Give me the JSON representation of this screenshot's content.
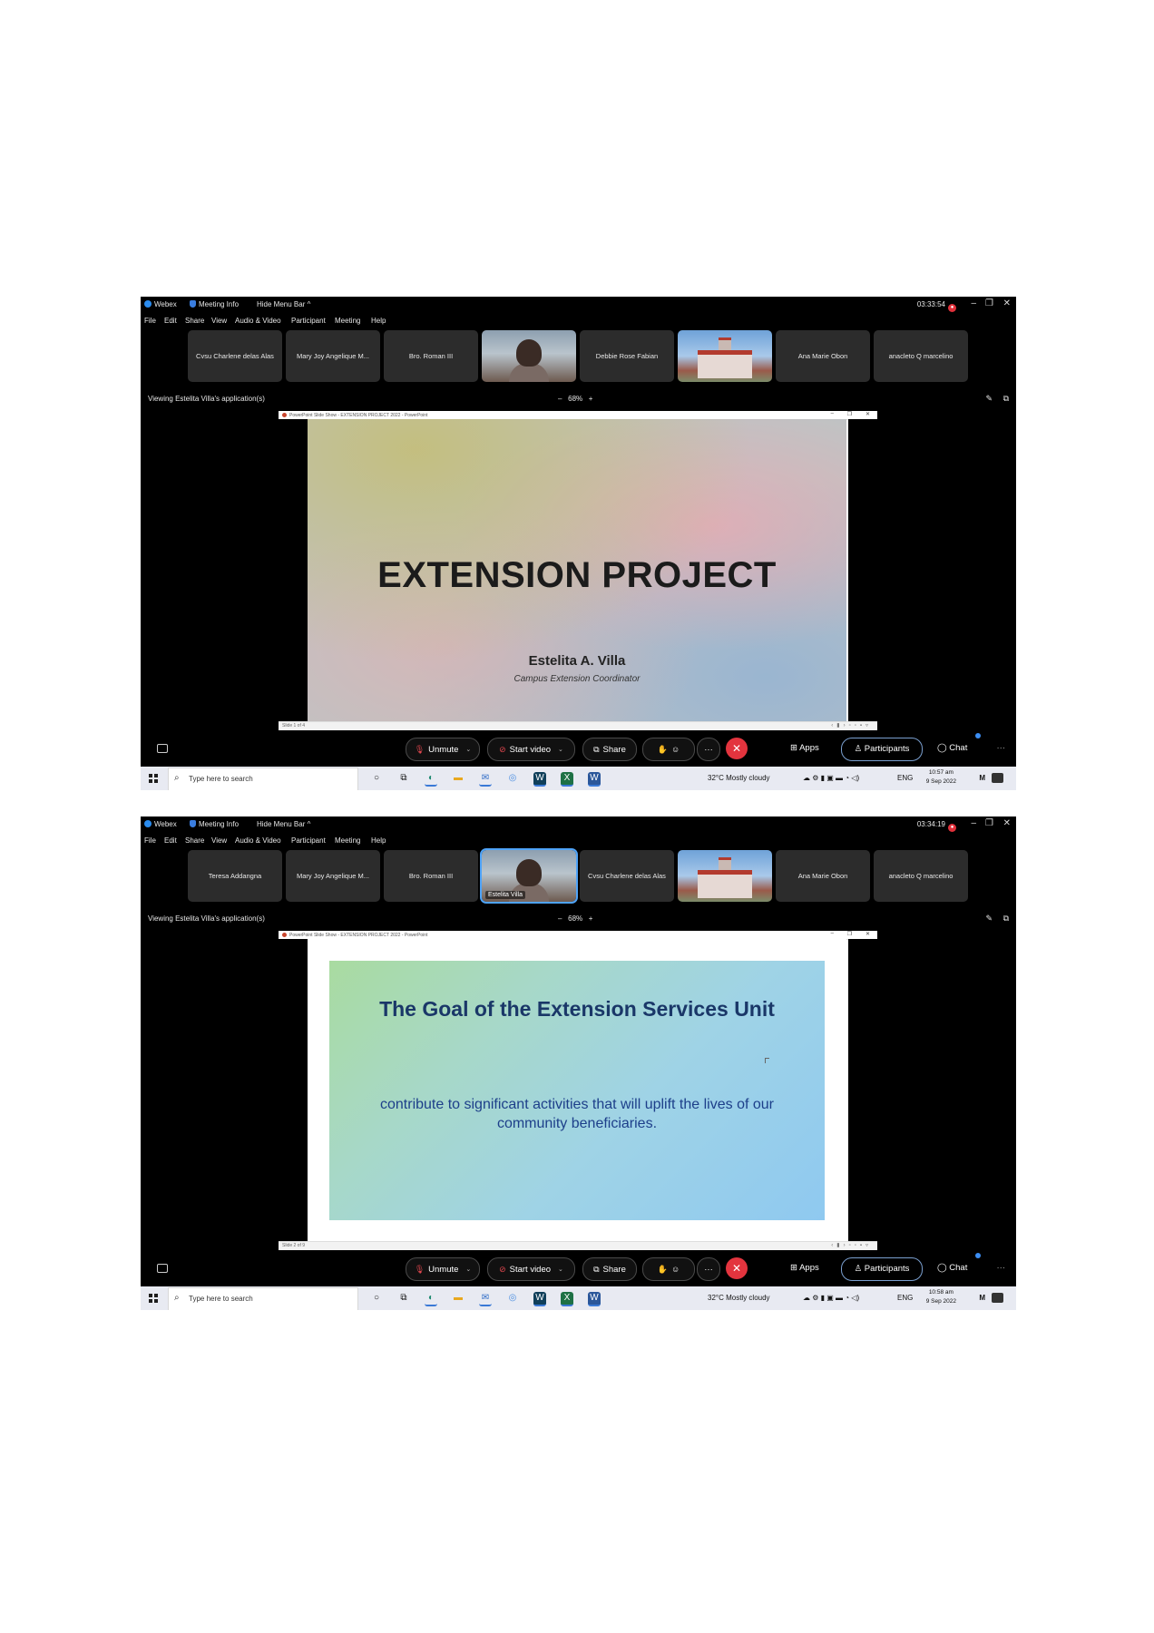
{
  "screenshots": [
    {
      "titlebar": {
        "app": "Webex",
        "meeting_info": "Meeting Info",
        "hide_menu": "Hide Menu Bar ^",
        "timer": "03:33:54"
      },
      "menu": [
        "File",
        "Edit",
        "Share",
        "View",
        "Audio & Video",
        "Participant",
        "Meeting",
        "Help"
      ],
      "participants": [
        "Cvsu Charlene delas Alas",
        "Mary Joy Angelique M...",
        "Bro. Roman III",
        "",
        "Debbie Rose Fabian",
        "",
        "Ana Marie Obon",
        "anacleto Q marcelino"
      ],
      "viewing": "Viewing Estelita Villa's application(s)",
      "zoom": "68%",
      "ppt_title": "PowerPoint Slide Show - EXTENSION PROJECT 2022 - PowerPoint",
      "ppt_status": "Slide 1 of 4",
      "slide": {
        "title": "EXTENSION PROJECT",
        "name": "Estelita A. Villa",
        "role": "Campus Extension Coordinator"
      },
      "controls": {
        "unmute": "Unmute",
        "start_video": "Start video",
        "share": "Share",
        "apps": "Apps",
        "participants": "Participants",
        "chat": "Chat"
      },
      "taskbar": {
        "search_placeholder": "Type here to search",
        "weather": "32°C  Mostly cloudy",
        "lang": "ENG",
        "time": "10:57 am",
        "date": "9 Sep 2022"
      }
    },
    {
      "titlebar": {
        "app": "Webex",
        "meeting_info": "Meeting Info",
        "hide_menu": "Hide Menu Bar ^",
        "timer": "03:34:19"
      },
      "menu": [
        "File",
        "Edit",
        "Share",
        "View",
        "Audio & Video",
        "Participant",
        "Meeting",
        "Help"
      ],
      "participants": [
        "Teresa Addangna",
        "Mary Joy Angelique M...",
        "Bro. Roman III",
        "Estelita Villa",
        "Cvsu Charlene delas Alas",
        "",
        "Ana Marie Obon",
        "anacleto Q marcelino"
      ],
      "viewing": "Viewing Estelita Villa's application(s)",
      "zoom": "68%",
      "ppt_title": "PowerPoint Slide Show - EXTENSION PROJECT 2022 - PowerPoint",
      "ppt_status": "Slide 2 of 9",
      "slide": {
        "title": "The Goal of the Extension Services Unit",
        "body": "contribute to significant activities that will uplift the lives of our community beneficiaries."
      },
      "controls": {
        "unmute": "Unmute",
        "start_video": "Start video",
        "share": "Share",
        "apps": "Apps",
        "participants": "Participants",
        "chat": "Chat"
      },
      "taskbar": {
        "search_placeholder": "Type here to search",
        "weather": "32°C  Mostly cloudy",
        "lang": "ENG",
        "time": "10:58 am",
        "date": "9 Sep 2022"
      }
    }
  ],
  "colors": {
    "webex_blue": "#2a8cf0",
    "end_call_red": "#e3343e",
    "slide2_title": "#1a3768"
  },
  "icons": [
    "webex-logo-icon",
    "shield-icon",
    "record-icon",
    "microphone-muted-icon",
    "video-off-icon",
    "share-screen-icon",
    "reactions-icon",
    "more-icon",
    "end-call-icon",
    "apps-icon",
    "participants-icon",
    "chat-icon",
    "windows-start-icon",
    "search-icon"
  ]
}
